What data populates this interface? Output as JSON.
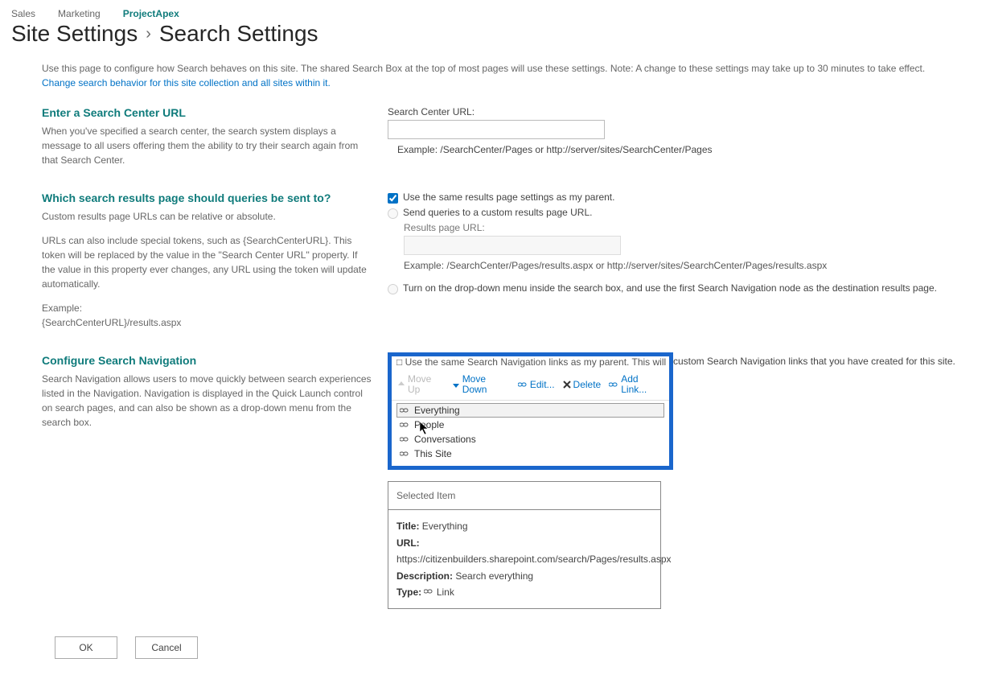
{
  "breadcrumb": {
    "items": [
      "Sales",
      "Marketing",
      "ProjectApex"
    ],
    "activeIndex": 2
  },
  "title": {
    "a": "Site Settings",
    "b": "Search Settings"
  },
  "intro": {
    "text": "Use this page to configure how Search behaves on this site. The shared Search Box at the top of most pages will use these settings. Note: A change to these settings may take up to 30 minutes to take effect.",
    "link": "Change search behavior for this site collection and all sites within it."
  },
  "s1": {
    "heading": "Enter a Search Center URL",
    "desc": "When you've specified a search center, the search system displays a message to all users offering them the ability to try their search again from that Search Center.",
    "fieldLabel": "Search Center URL:",
    "example": "Example: /SearchCenter/Pages or http://server/sites/SearchCenter/Pages"
  },
  "s2": {
    "heading": "Which search results page should queries be sent to?",
    "d1": "Custom results page URLs can be relative or absolute.",
    "d2": "URLs can also include special tokens, such as {SearchCenterURL}. This token will be replaced by the value in the \"Search Center URL\" property. If the value in this property ever changes, any URL using the token will update automatically.",
    "d3a": "Example:",
    "d3b": "{SearchCenterURL}/results.aspx",
    "cb1": "Use the same results page settings as my parent.",
    "r1": "Send queries to a custom results page URL.",
    "rpLabel": "Results page URL:",
    "rpExample": "Example: /SearchCenter/Pages/results.aspx or http://server/sites/SearchCenter/Pages/results.aspx",
    "r2": "Turn on the drop-down menu inside the search box, and use the first Search Navigation node as the destination results page."
  },
  "s3": {
    "heading": "Configure Search Navigation",
    "desc": "Search Navigation allows users to move quickly between search experiences listed in the Navigation. Navigation is displayed in the Quick Launch control on search pages, and can also be shown as a drop-down menu from the search box.",
    "cbSnippet": "Use the same Search Navigation links as my parent. This will delete al",
    "overlayText": " custom Search Navigation links that you have created for this site."
  },
  "toolbar": {
    "moveUp": "Move Up",
    "moveDown": "Move Down",
    "edit": "Edit...",
    "delete": "Delete",
    "addLink": "Add Link..."
  },
  "navItems": [
    {
      "label": "Everything",
      "selected": true
    },
    {
      "label": "People",
      "selected": false
    },
    {
      "label": "Conversations",
      "selected": false
    },
    {
      "label": "This Site",
      "selected": false
    }
  ],
  "selected": {
    "head": "Selected Item",
    "titleLabel": "Title:",
    "titleValue": "Everything",
    "urlLabel": "URL:",
    "urlValue": "https://citizenbuilders.sharepoint.com/search/Pages/results.aspx",
    "descLabel": "Description:",
    "descValue": "Search everything",
    "typeLabel": "Type:",
    "typeValue": "Link"
  },
  "buttons": {
    "ok": "OK",
    "cancel": "Cancel"
  }
}
